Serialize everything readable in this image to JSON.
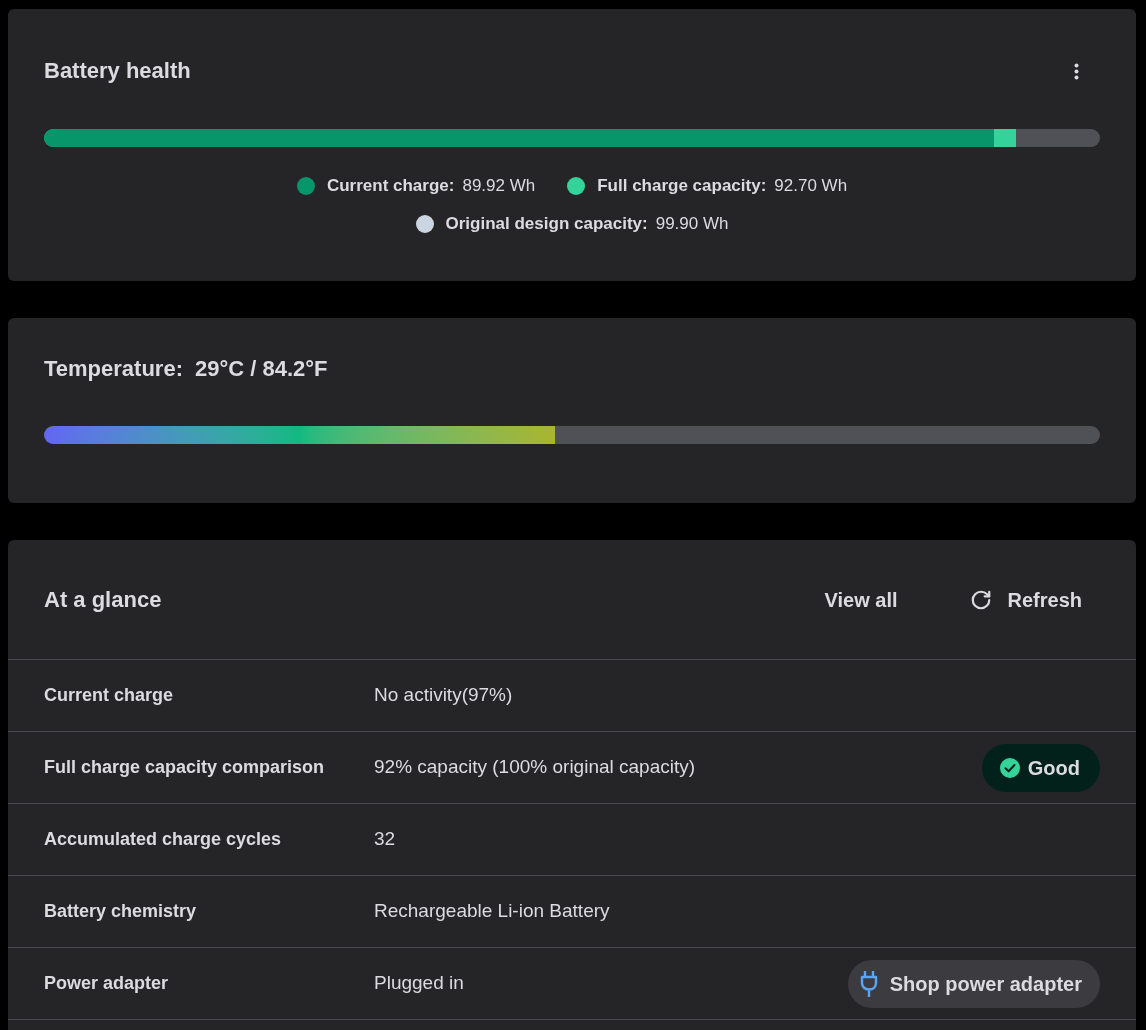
{
  "battery_health": {
    "title": "Battery health",
    "bar_segments": [
      {
        "level": 0.9,
        "color": "#079669"
      },
      {
        "level": 0.92,
        "color": "#34d399"
      }
    ],
    "legend": [
      {
        "label": "Current charge:",
        "value": "89.92 Wh",
        "color": "#079669"
      },
      {
        "label": "Full charge capacity:",
        "value": "92.70 Wh",
        "color": "#34d399"
      },
      {
        "label": "Original design capacity:",
        "value": "99.90 Wh",
        "color": "#cbd5e1"
      }
    ]
  },
  "temperature": {
    "label": "Temperature:",
    "value": "29°C / 84.2°F",
    "level": 0.484
  },
  "at_a_glance": {
    "title": "At a glance",
    "actions": [
      {
        "kind": "link",
        "label": "View all"
      },
      {
        "kind": "refresh",
        "label": "Refresh"
      }
    ],
    "rows": [
      {
        "label": "Current charge",
        "value": "No activity(97%)"
      },
      {
        "label": "Full charge capacity comparison",
        "value": "92% capacity (100% original capacity)",
        "extra": {
          "kind": "status",
          "text": "Good"
        }
      },
      {
        "label": "Accumulated charge cycles",
        "value": "32"
      },
      {
        "label": "Battery chemistry",
        "value": "Rechargeable Li-ion Battery"
      },
      {
        "label": "Power adapter",
        "value": "Plugged in",
        "extra": {
          "kind": "shop",
          "text": "Shop power adapter"
        }
      }
    ]
  }
}
